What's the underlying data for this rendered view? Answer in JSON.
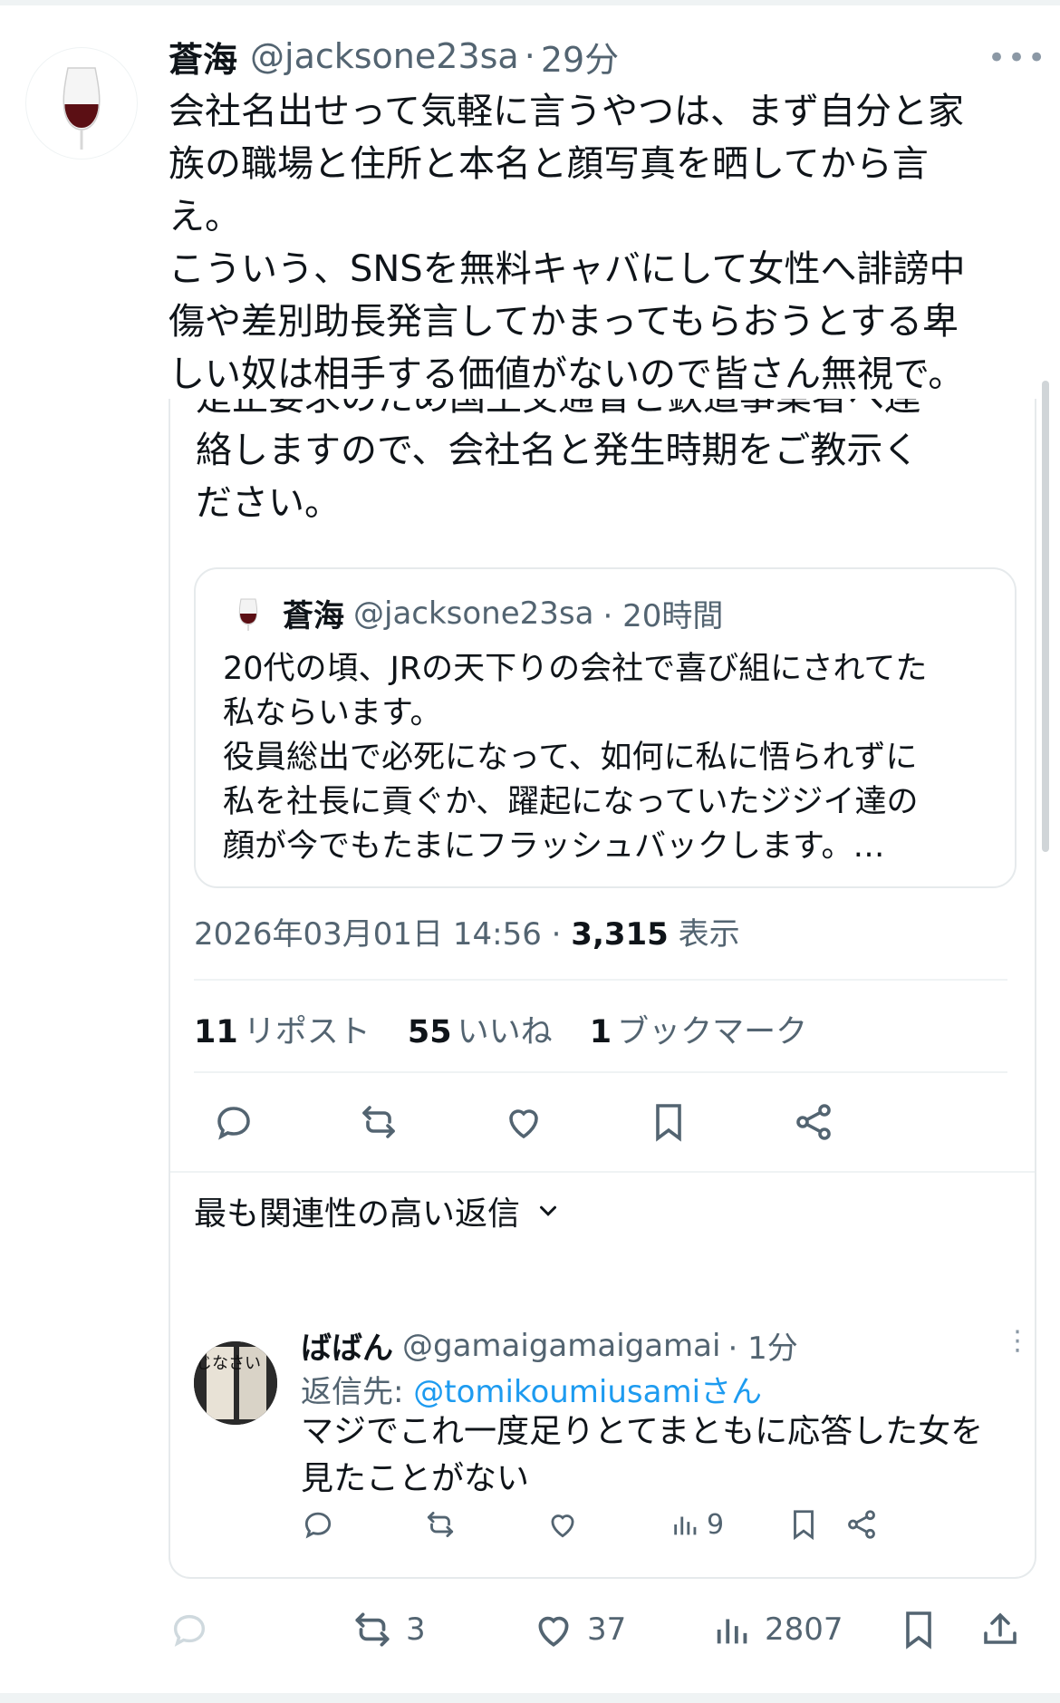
{
  "tweet": {
    "author_name": "蒼海",
    "handle": "@jacksone23sa",
    "time_sep": "·",
    "time": "29分",
    "text_lines": [
      "会社名出せって気軽に言うやつは、まず自分と家",
      "族の職場と住所と本名と顔写真を晒してから言",
      "え。",
      "こういう、SNSを無料キャバにして女性へ誹謗中",
      "傷や差別助長発言してかまってもらおうとする卑",
      "しい奴は相手する価値がないので皆さん無視で。"
    ]
  },
  "quoted": {
    "cut_lines": [
      "是正要求のため国土交通省と鉄道事業者へ連",
      "絡しますので、会社名と発生時期をご教示く",
      "ださい。"
    ],
    "inner": {
      "author_name": "蒼海",
      "handle": "@jacksone23sa",
      "time": "· 20時間",
      "text_lines": [
        "20代の頃、JRの天下りの会社で喜び組にされてた",
        "私ならいます。",
        "役員総出で必死になって、如何に私に悟られずに",
        "私を社長に貢ぐか、躍起になっていたジジイ達の",
        "顔が今でもたまにフラッシュバックします。…"
      ]
    },
    "meta": {
      "date": "2026年03月01日 14:56 ·",
      "views": "3,315",
      "views_label": "表示"
    },
    "stats": {
      "reposts": "11",
      "reposts_label": "リポスト",
      "likes": "55",
      "likes_label": "いいね",
      "bookmarks": "1",
      "bookmarks_label": "ブックマーク"
    },
    "sort_label": "最も関連性の高い返信",
    "reply": {
      "author_name": "ばばん",
      "handle": "@gamaigamaigamai",
      "time": "· 1分",
      "reply_to_label": "返信先:",
      "reply_to_handle": "@tomikoumiusami",
      "reply_to_suffix": "さん",
      "text_lines": [
        "マジでこれ一度足りとてまともに応答した女を",
        "見たことがない"
      ],
      "views": "9",
      "avatar_glyphs": "信じなさい"
    }
  },
  "bottom_bar": {
    "retweets": "3",
    "likes": "37",
    "views": "2807"
  },
  "colors": {
    "text": "#0f1419",
    "muted": "#536471",
    "link": "#1d9bf0",
    "border": "#eff3f4"
  },
  "icons": [
    "reply-icon",
    "retweet-icon",
    "like-icon",
    "bookmark-icon",
    "share-icon",
    "views-icon",
    "more-icon",
    "chevron-down-icon"
  ]
}
